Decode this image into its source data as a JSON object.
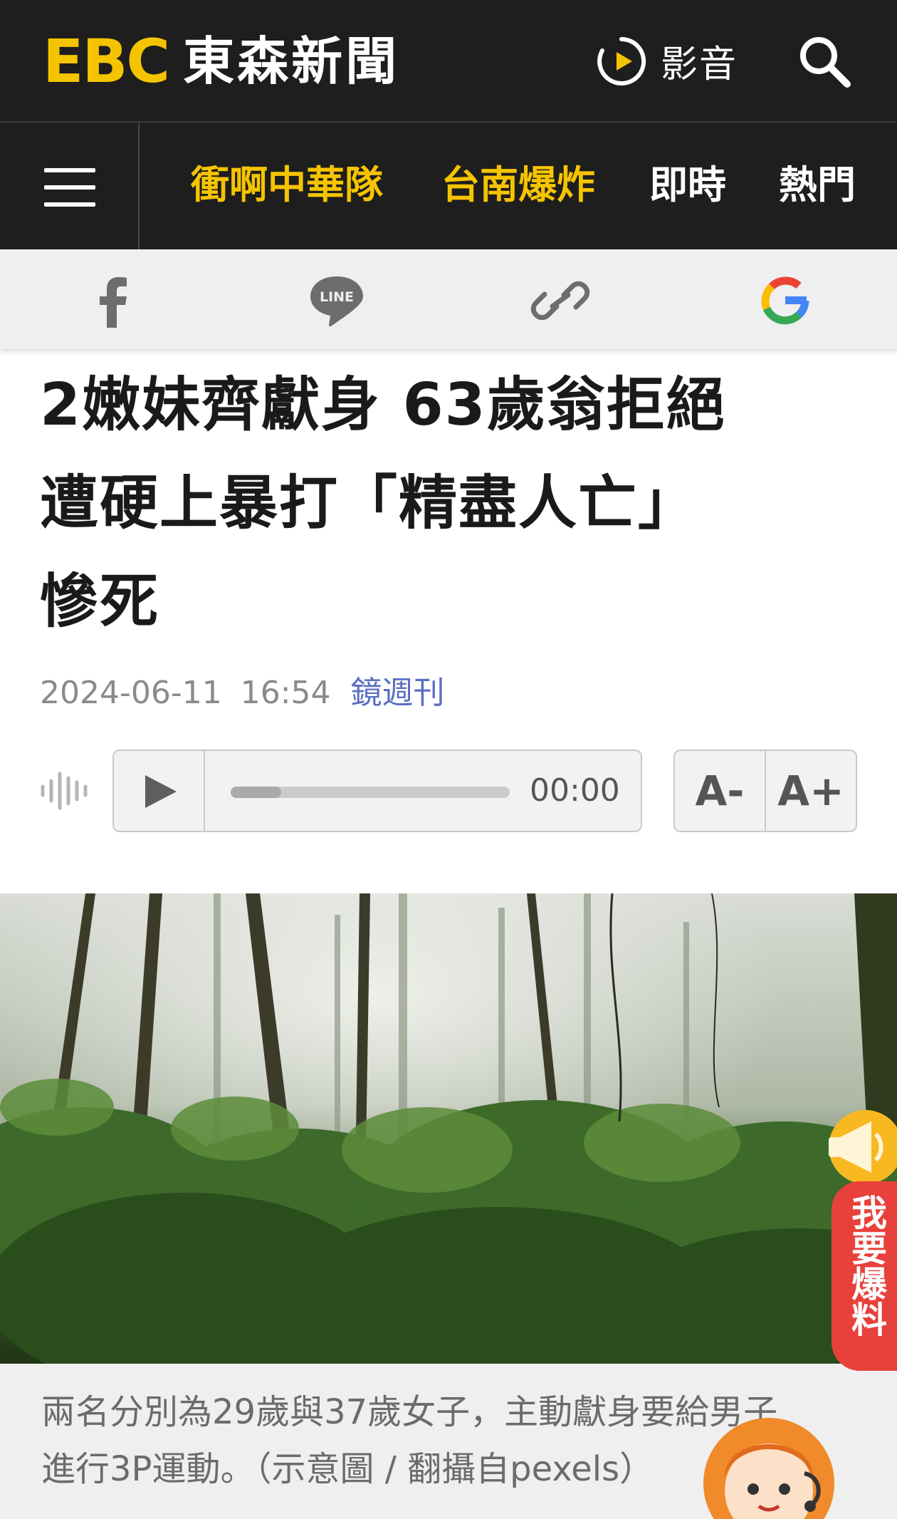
{
  "header": {
    "logo_text": "EBC",
    "site_name": "東森新聞",
    "media_label": "影音",
    "brand_color": "#f5c400",
    "icons": [
      "play-circle-icon",
      "search-icon"
    ]
  },
  "nav": {
    "items": [
      {
        "label": "衝啊中華隊",
        "color": "#f5c400"
      },
      {
        "label": "台南爆炸",
        "color": "#f5c400"
      },
      {
        "label": "即時",
        "color": "#ffffff"
      },
      {
        "label": "熱門",
        "color": "#ffffff"
      }
    ]
  },
  "share": {
    "icons": [
      "facebook-icon",
      "line-icon",
      "link-icon",
      "google-icon"
    ],
    "line_label": "LINE"
  },
  "article": {
    "title_line1": "2嫩妹齊獻身 63歲翁拒絕",
    "title_line2": "遭硬上暴打「精盡人亡」",
    "title_line3": "慘死",
    "date": "2024-06-11",
    "time": "16:54",
    "source": "鏡週刊"
  },
  "player": {
    "time": "00:00",
    "progress": 0.18,
    "font_smaller": "A-",
    "font_larger": "A+"
  },
  "photo": {
    "caption_line1": "兩名分別為29歲與37歲女子，主動獻身要給男子",
    "caption_line2": "進行3P運動。（示意圖 / 翻攝自pexels）"
  },
  "widgets": {
    "report_label": "我要爆料",
    "report_color": "#e8413b"
  }
}
